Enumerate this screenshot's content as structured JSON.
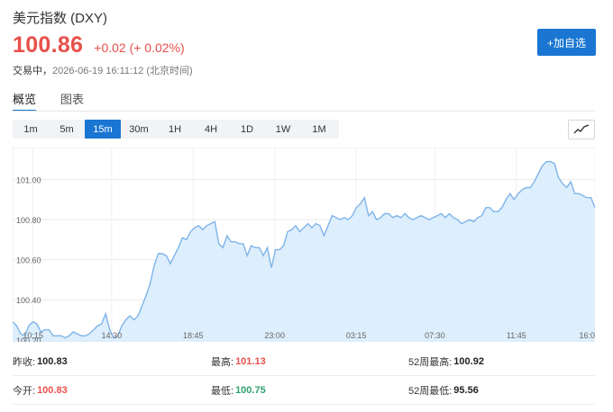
{
  "header": {
    "title": "美元指数 (DXY)",
    "price": "100.86",
    "change": "+0.02 (+ 0.02%)",
    "status_label": "交易中",
    "timestamp": "2026-06-19 16:11:12 (北京时间)",
    "add_button": "+加自选"
  },
  "tabs": [
    {
      "label": "概览",
      "active": true
    },
    {
      "label": "图表",
      "active": false
    }
  ],
  "intervals": [
    {
      "label": "1m"
    },
    {
      "label": "5m"
    },
    {
      "label": "15m",
      "active": true
    },
    {
      "label": "30m"
    },
    {
      "label": "1H"
    },
    {
      "label": "4H"
    },
    {
      "label": "1D"
    },
    {
      "label": "1W"
    },
    {
      "label": "1M"
    }
  ],
  "chart_type_icon": "line-chart-icon",
  "chart_data": {
    "type": "area",
    "title": "",
    "xlabel": "",
    "ylabel": "",
    "ylim": [
      100.19,
      101.16
    ],
    "yticks": [
      "100.20",
      "100.40",
      "100.60",
      "100.80",
      "101.00"
    ],
    "xticks": [
      "10:15",
      "14:30",
      "18:45",
      "23:00",
      "03:15",
      "07:30",
      "11:45",
      "16:0"
    ],
    "grid": true,
    "line_color": "#7fb4e8",
    "fill_color": "#ddeefc",
    "values": [
      100.29,
      100.27,
      100.23,
      100.22,
      100.27,
      100.29,
      100.28,
      100.24,
      100.25,
      100.25,
      100.22,
      100.22,
      100.22,
      100.21,
      100.22,
      100.24,
      100.23,
      100.22,
      100.22,
      100.23,
      100.25,
      100.27,
      100.28,
      100.33,
      100.25,
      100.21,
      100.22,
      100.27,
      100.3,
      100.32,
      100.3,
      100.32,
      100.37,
      100.42,
      100.48,
      100.57,
      100.63,
      100.63,
      100.62,
      100.58,
      100.62,
      100.66,
      100.71,
      100.7,
      100.74,
      100.76,
      100.77,
      100.75,
      100.77,
      100.78,
      100.79,
      100.68,
      100.66,
      100.72,
      100.69,
      100.69,
      100.68,
      100.68,
      100.62,
      100.67,
      100.66,
      100.66,
      100.62,
      100.66,
      100.56,
      100.65,
      100.65,
      100.67,
      100.74,
      100.75,
      100.77,
      100.74,
      100.76,
      100.78,
      100.76,
      100.78,
      100.77,
      100.72,
      100.77,
      100.82,
      100.81,
      100.8,
      100.81,
      100.8,
      100.82,
      100.86,
      100.88,
      100.91,
      100.82,
      100.84,
      100.8,
      100.81,
      100.83,
      100.83,
      100.81,
      100.82,
      100.81,
      100.83,
      100.81,
      100.8,
      100.81,
      100.82,
      100.81,
      100.8,
      100.81,
      100.82,
      100.83,
      100.81,
      100.83,
      100.81,
      100.8,
      100.78,
      100.79,
      100.8,
      100.79,
      100.81,
      100.82,
      100.86,
      100.86,
      100.84,
      100.84,
      100.86,
      100.9,
      100.93,
      100.9,
      100.93,
      100.95,
      100.96,
      100.96,
      100.99,
      101.03,
      101.07,
      101.09,
      101.09,
      101.08,
      101.01,
      100.98,
      100.96,
      100.99,
      100.93,
      100.93,
      100.92,
      100.91,
      100.91,
      100.86
    ]
  },
  "stats": [
    [
      {
        "label": "昨收:",
        "value": "100.83",
        "color": "#222222"
      },
      {
        "label": "最高:",
        "value": "101.13",
        "color": "#e8504a"
      },
      {
        "label": "52周最高:",
        "value": "100.92",
        "color": "#222222"
      }
    ],
    [
      {
        "label": "今开:",
        "value": "100.83",
        "color": "#e8504a"
      },
      {
        "label": "最低:",
        "value": "100.75",
        "color": "#2ea36d"
      },
      {
        "label": "52周最低:",
        "value": "95.56",
        "color": "#222222"
      }
    ]
  ]
}
